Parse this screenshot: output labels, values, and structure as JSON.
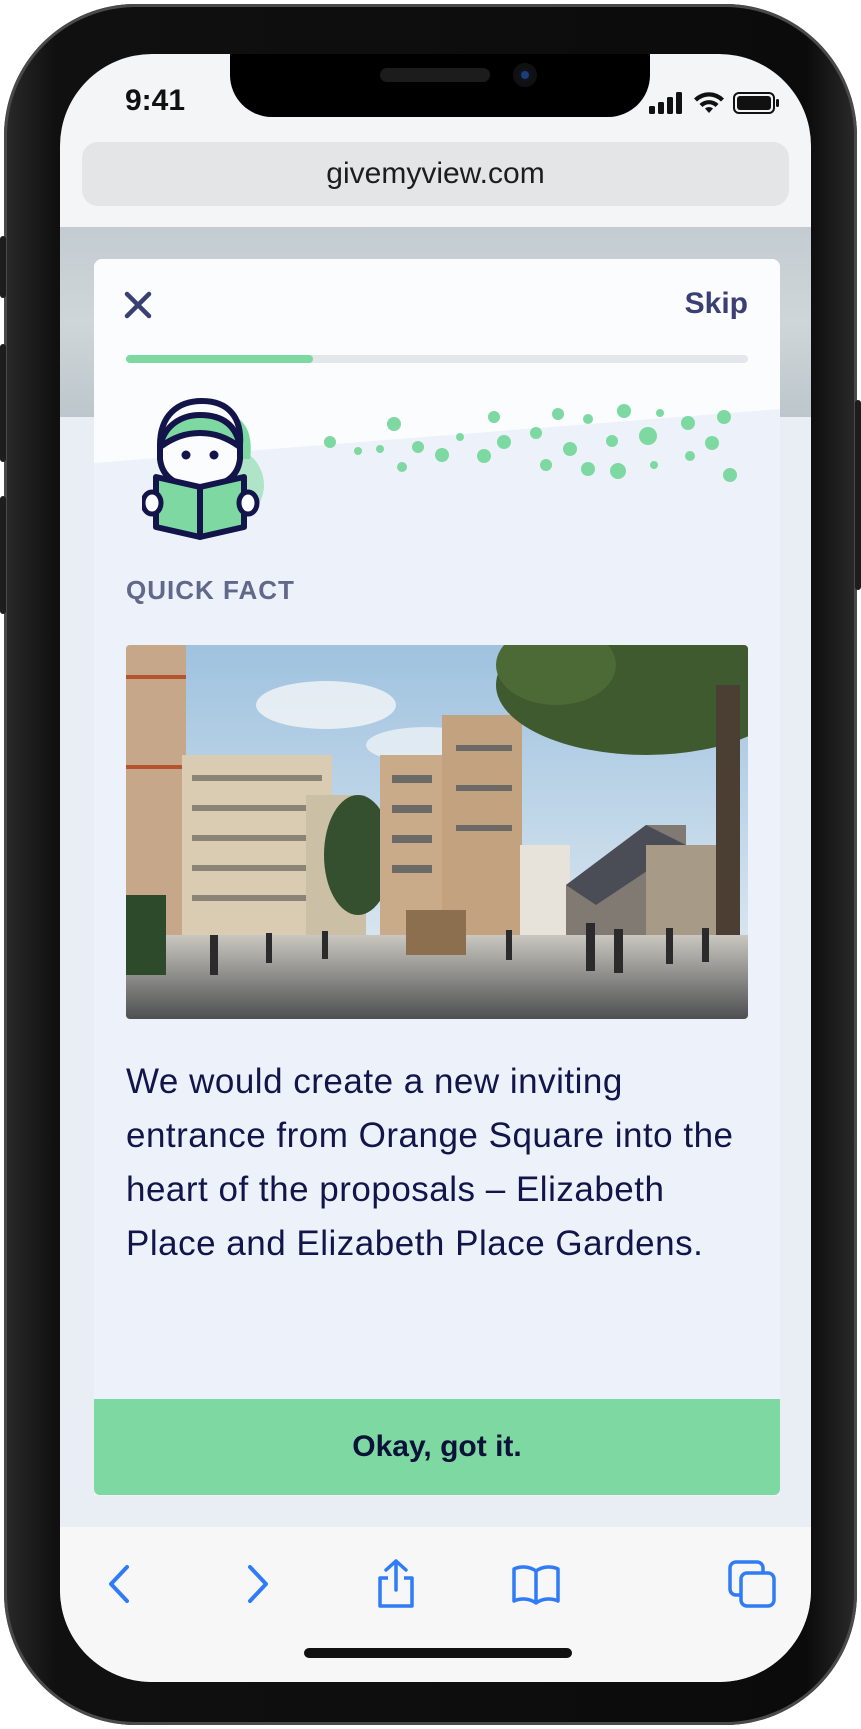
{
  "status_bar": {
    "time": "9:41"
  },
  "browser": {
    "url": "givemyview.com"
  },
  "modal": {
    "skip_label": "Skip",
    "progress": 0.3,
    "eyebrow": "QUICK FACT",
    "body": "We would create a new inviting entrance from Orange Square into the heart of the proposals – Elizabeth Place and Elizabeth Place Gardens.",
    "cta_label": "Okay, got it."
  },
  "toolbar": {
    "buttons": [
      "back-icon",
      "forward-icon",
      "share-icon",
      "bookmarks-icon",
      "tabs-icon"
    ]
  },
  "colors": {
    "accent": "#7dd9a1",
    "navy": "#13154a",
    "system_blue": "#2f7cf6"
  }
}
